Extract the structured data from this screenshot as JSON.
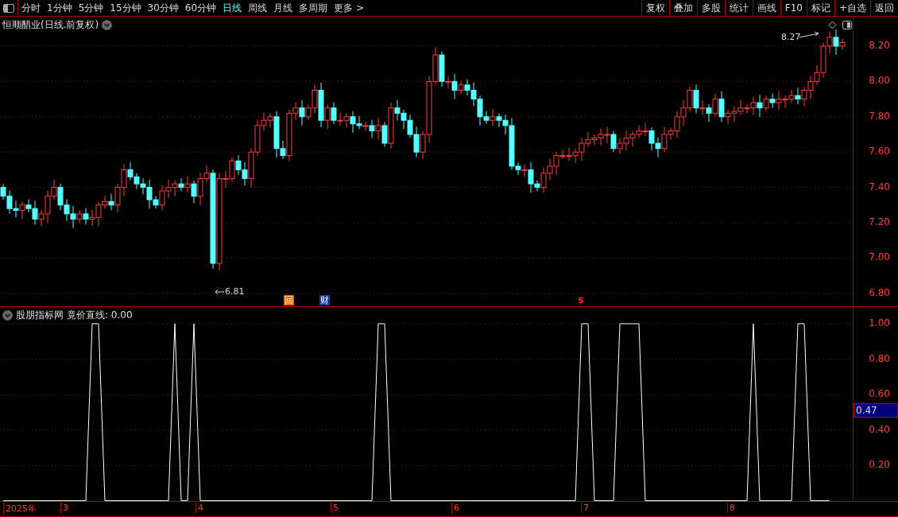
{
  "toolbar": {
    "periods": [
      {
        "label": "分时",
        "selected": false
      },
      {
        "label": "1分钟",
        "selected": false
      },
      {
        "label": "5分钟",
        "selected": false
      },
      {
        "label": "15分钟",
        "selected": false
      },
      {
        "label": "30分钟",
        "selected": false
      },
      {
        "label": "60分钟",
        "selected": false
      },
      {
        "label": "日线",
        "selected": true
      },
      {
        "label": "周线",
        "selected": false
      },
      {
        "label": "月线",
        "selected": false
      },
      {
        "label": "多周期",
        "selected": false
      },
      {
        "label": "更多 >",
        "selected": false
      }
    ],
    "buttons": [
      "复权",
      "叠加",
      "多股",
      "统计",
      "画线",
      "F10",
      "标记",
      "+自选",
      "返回"
    ]
  },
  "price_chart": {
    "title": "恒顺醋业(日线.前复权)",
    "high_label": "8.27",
    "low_label": "6.81",
    "markers": [
      {
        "kind": "box",
        "text": "回",
        "color": "#e07000"
      },
      {
        "kind": "box",
        "text": "财",
        "color": "#1a3f8f"
      },
      {
        "kind": "plain",
        "text": "$",
        "color": "#ff2020"
      }
    ],
    "price_ticks": [
      "8.20",
      "8.00",
      "7.80",
      "7.60",
      "7.40",
      "7.20",
      "7.00",
      "6.80"
    ]
  },
  "indicator": {
    "title": "股朋指标网",
    "reading": ": 0.00",
    "cursor_value": "0.47",
    "chart_data": {
      "type": "line",
      "ylim": [
        0,
        1
      ],
      "grid": true,
      "yticks": [
        {
          "value": 1,
          "label": "1.00"
        },
        {
          "value": 0.8,
          "label": "0.80"
        },
        {
          "value": 0.6,
          "label": "0.60"
        },
        {
          "value": 0.4,
          "label": "0.40"
        },
        {
          "value": 0.2,
          "label": "0.20"
        }
      ],
      "series": [
        {
          "name": "竟价直线",
          "color": "#ffffff",
          "values": [
            0,
            0,
            0,
            0,
            0,
            0,
            0,
            0,
            0,
            0,
            0,
            0,
            0,
            0,
            1,
            1,
            0,
            0,
            0,
            0,
            0,
            0,
            0,
            0,
            0,
            0,
            0,
            1,
            0,
            0,
            1,
            0,
            0,
            0,
            0,
            0,
            0,
            0,
            0,
            0,
            0,
            0,
            0,
            0,
            0,
            0,
            0,
            0,
            0,
            0,
            0,
            0,
            0,
            0,
            0,
            0,
            0,
            0,
            0,
            1,
            1,
            0,
            0,
            0,
            0,
            0,
            0,
            0,
            0,
            0,
            0,
            0,
            0,
            0,
            0,
            0,
            0,
            0,
            0,
            0,
            0,
            0,
            0,
            0,
            0,
            0,
            0,
            0,
            0,
            0,
            0,
            1,
            1,
            0,
            0,
            0,
            0,
            1,
            1,
            1,
            1,
            0,
            0,
            0,
            0,
            0,
            0,
            0,
            0,
            0,
            0,
            0,
            0,
            0,
            0,
            0,
            0,
            0,
            1,
            0,
            0,
            0,
            0,
            0,
            0,
            1,
            1,
            0,
            0,
            0,
            0
          ]
        }
      ]
    }
  },
  "date_axis": [
    "2025年",
    "3",
    "4",
    "5",
    "6",
    "7",
    "8"
  ]
}
